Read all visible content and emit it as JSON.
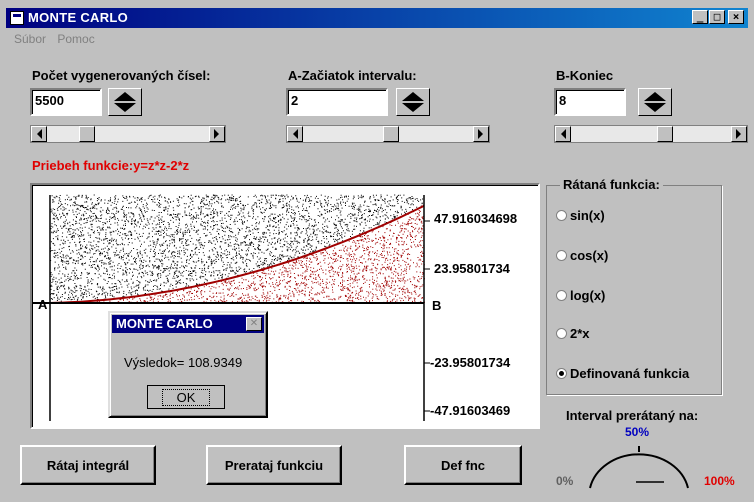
{
  "window": {
    "title": "MONTE CARLO",
    "buttons": [
      "_",
      "□",
      "×"
    ]
  },
  "menu": [
    "Súbor",
    "Pomoc"
  ],
  "inputs": {
    "count": {
      "label": "Počet vygenerovaných čísel:",
      "value": "5500",
      "slider": 0.22
    },
    "a": {
      "label": "A-Začiatok intervalu:",
      "value": "2",
      "slider": 0.52
    },
    "b": {
      "label": "B-Koniec",
      "value": "8",
      "slider": 0.6
    }
  },
  "function_label": "Priebeh funkcie:y=z*z-2*z",
  "plot": {
    "y_ticks": [
      "47.916034698",
      "23.95801734",
      "-23.95801734",
      "-47.91603469"
    ],
    "label_a": "A",
    "label_b": "B",
    "colors": {
      "above": "#000000",
      "below": "#a00000",
      "curve": "#a00000"
    }
  },
  "group": {
    "title": "Rátaná funkcia:",
    "options": [
      {
        "label": "sin(x)",
        "selected": false
      },
      {
        "label": "cos(x)",
        "selected": false
      },
      {
        "label": "log(x)",
        "selected": false
      },
      {
        "label": "2*x",
        "selected": false
      },
      {
        "label": "Definovaná funkcia",
        "selected": true
      }
    ]
  },
  "buttons": {
    "integrate": "Rátaj integrál",
    "redraw": "Prerataj funkciu",
    "def": "Def fnc"
  },
  "gauge": {
    "title": "Interval prerátaný na:",
    "min": "0%",
    "mid": "50%",
    "max": "100%",
    "colors": {
      "mid": "#0000c0",
      "max": "#e00000",
      "min": "#606060"
    }
  },
  "dialog": {
    "title": "MONTE CARLO",
    "message": "Výsledok= 108.9349",
    "ok": "OK"
  }
}
